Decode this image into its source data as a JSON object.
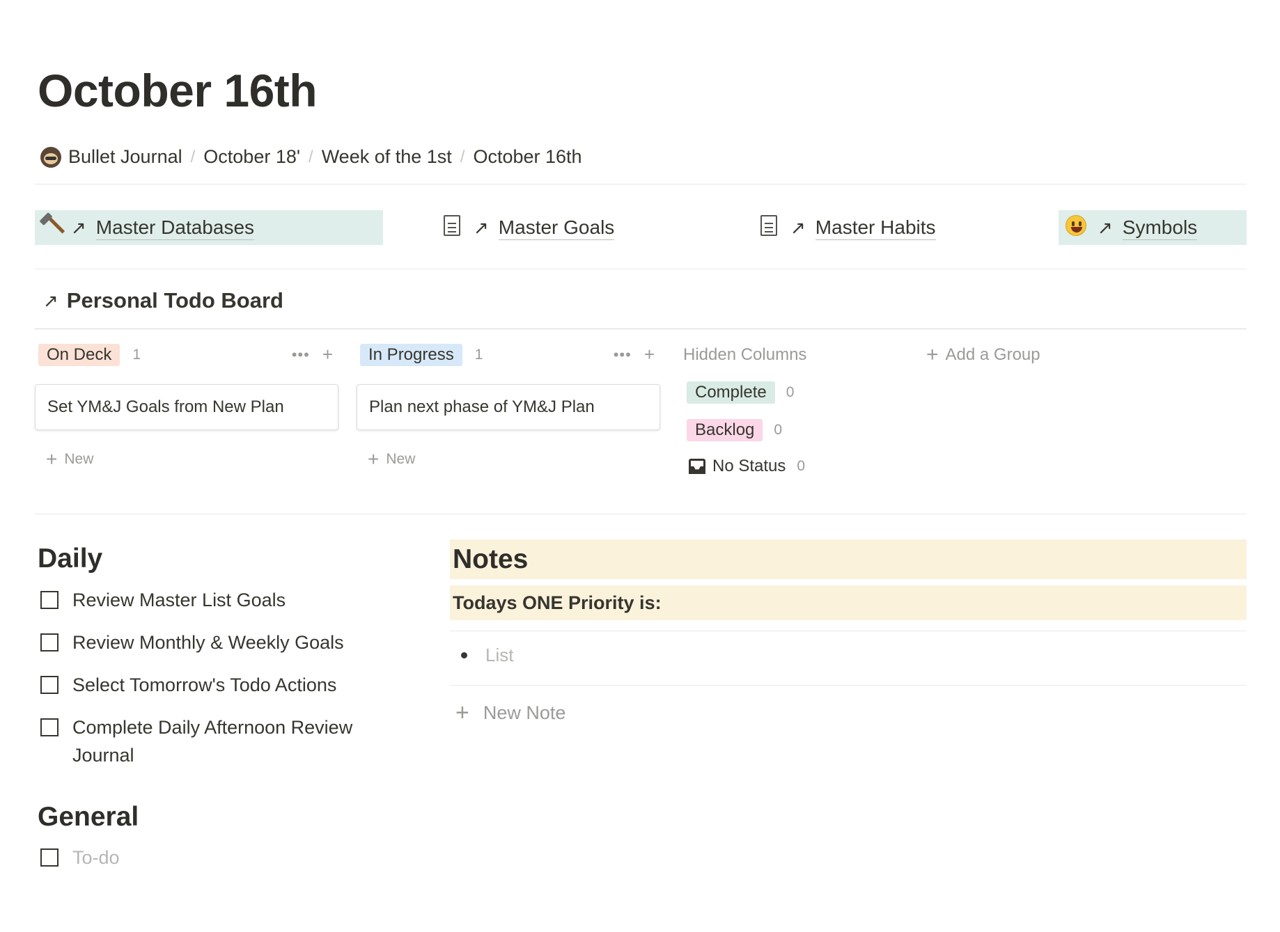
{
  "page": {
    "title": "October 16th"
  },
  "breadcrumb": {
    "items": [
      "Bullet Journal",
      "October 18'",
      "Week of the 1st",
      "October 16th"
    ],
    "separator": "/"
  },
  "links": [
    {
      "label": "Master Databases",
      "icon": "hammer-icon",
      "highlight": true
    },
    {
      "label": "Master Goals",
      "icon": "page-icon",
      "highlight": false
    },
    {
      "label": "Master Habits",
      "icon": "page-icon",
      "highlight": false
    },
    {
      "label": "Symbols",
      "icon": "smiley-icon",
      "highlight": true
    }
  ],
  "link_arrow": "↗",
  "board": {
    "title": "Personal Todo Board",
    "columns": [
      {
        "name": "On Deck",
        "count": "1",
        "card": "Set YM&J Goals from New Plan",
        "new_label": "New",
        "color": "#fbe1d6"
      },
      {
        "name": "In Progress",
        "count": "1",
        "card": "Plan next phase of YM&J Plan",
        "new_label": "New",
        "color": "#d7e8f8"
      }
    ],
    "hidden": {
      "title": "Hidden Columns",
      "items": [
        {
          "name": "Complete",
          "count": "0",
          "color": "#d8ebe4"
        },
        {
          "name": "Backlog",
          "count": "0",
          "color": "#fbd7e7"
        },
        {
          "name": "No Status",
          "count": "0"
        }
      ]
    },
    "add_group": "Add a Group"
  },
  "daily": {
    "title": "Daily",
    "items": [
      "Review Master List Goals",
      "Review Monthly & Weekly Goals",
      "Select Tomorrow's Todo Actions",
      "Complete Daily Afternoon Review Journal"
    ]
  },
  "general": {
    "title": "General",
    "placeholder": "To-do"
  },
  "notes": {
    "title": "Notes",
    "priority": "Todays ONE Priority is:",
    "list_placeholder": "List",
    "new_note": "New Note",
    "highlight_color": "#fbf2dc"
  }
}
